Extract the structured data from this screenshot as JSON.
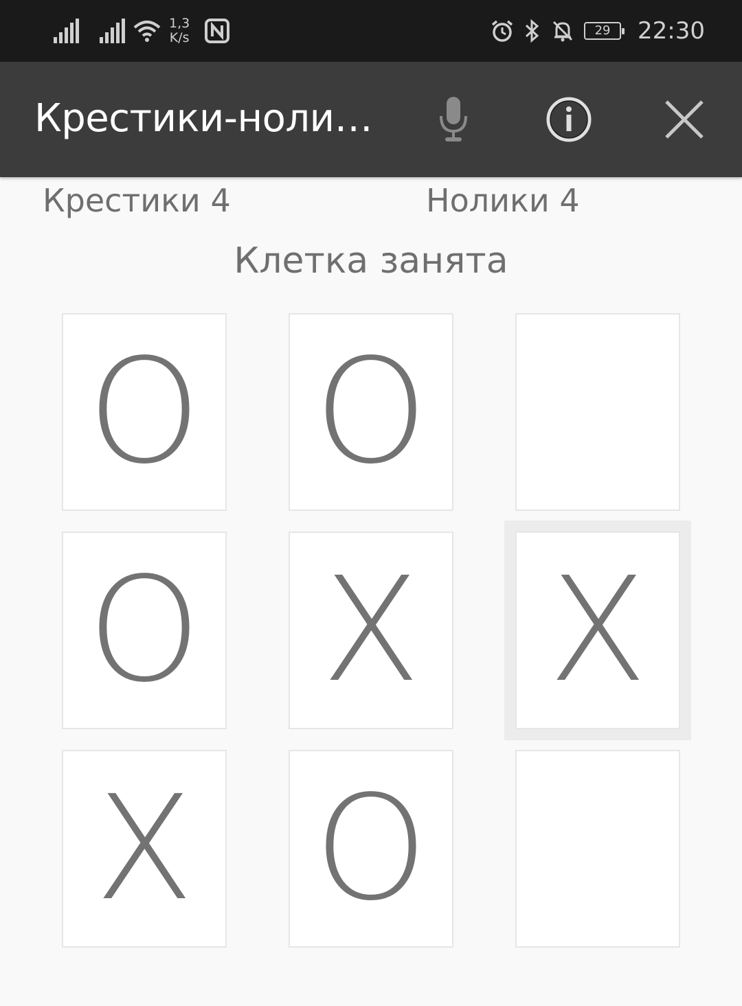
{
  "status_bar": {
    "net_speed_value": "1,3",
    "net_speed_unit": "K/s",
    "battery": "29",
    "time": "22:30"
  },
  "app_bar": {
    "title": "Крестики-нолики",
    "icons": [
      "microphone-icon",
      "info-icon",
      "close-icon"
    ]
  },
  "scores": {
    "crosses": "Крестики 4",
    "noughts": "Нолики 4"
  },
  "message": "Клетка занята",
  "board": [
    [
      "O",
      "O",
      ""
    ],
    [
      "O",
      "X",
      "X"
    ],
    [
      "X",
      "O",
      ""
    ]
  ],
  "selected_cell": "row 2, column 3",
  "colors": {
    "status_bar": "#1a1a1a",
    "app_bar": "#3c3c3c",
    "background": "#f9f9f9",
    "mark": "#737373",
    "text": "#6f6f6f"
  }
}
